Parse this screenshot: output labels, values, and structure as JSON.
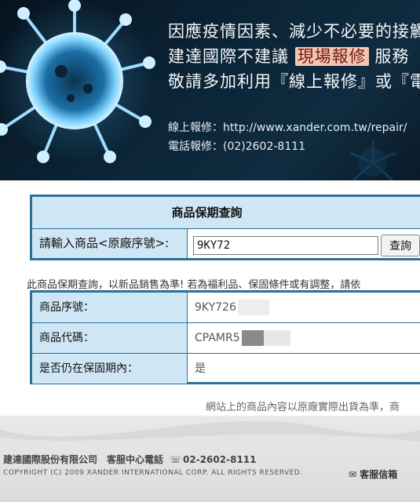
{
  "banner": {
    "line1": "因應疫情因素、減少不必要的接觸",
    "line2_prefix": "建達國際不建議",
    "line2_highlight": "現場報修",
    "line2_suffix": "服務",
    "line3": "敬請多加利用『線上報修』或『電",
    "contact_online": "線上報修：http://www.xander.com.tw/repair/",
    "contact_phone": "電話報修：(02)2602-8111"
  },
  "query": {
    "title": "商品保期查詢",
    "label": "請輸入商品<原廠序號>:",
    "input_value": "9KY72",
    "button": "查詢"
  },
  "notice": "此商品保期查詢，以新品銷售為準! 若為福利品、保固條件或有調整，請依",
  "results": [
    {
      "label": "商品序號：",
      "value": "9KY726"
    },
    {
      "label": "商品代碼：",
      "value": "CPAMR5"
    },
    {
      "label": "是否仍在保固期內：",
      "value": "是"
    }
  ],
  "footer": {
    "note": "網站上的商品內容以原廠實際出貨為準，商",
    "company": "建達國際股份有限公司　客服中心電話",
    "phone": "02-2602-8111",
    "copyright": "COPYRIGHT (C) 2009 XANDER INTERNATIONAL CORP. ALL RIGHTS RESERVED.",
    "mail": "客服信箱"
  },
  "colors": {
    "border": "#2f6f98",
    "cell_bg": "#cfe7f4",
    "highlight": "#f2c6b6"
  },
  "icons": [
    "virus-icon",
    "phone-icon",
    "mail-icon"
  ]
}
